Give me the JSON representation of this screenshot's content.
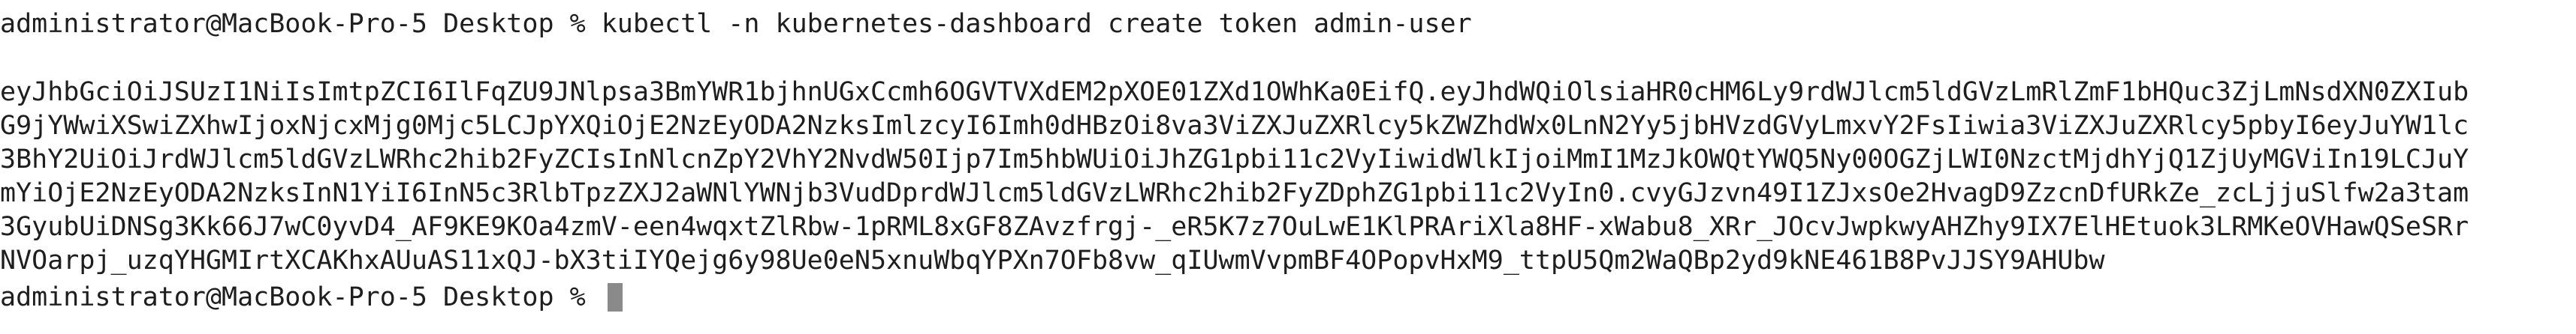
{
  "terminal": {
    "command_prompt": "administrator@MacBook-Pro-5 Desktop % ",
    "command": "kubectl -n kubernetes-dashboard create token admin-user",
    "output_lines": [
      "eyJhbGciOiJSUzI1NiIsImtpZCI6IlFqZU9JNlpsa3BmYWR1bjhnUGxCcmh6OGVTVXdEM2pXOE01ZXd1OWhKa0EifQ.eyJhdWQiOlsiaHR0cHM6Ly9rdWJlcm5ldGVzLmRlZmF1bHQuc3ZjLmNsdXN0ZXIub",
      "G9jYWwiXSwiZXhwIjoxNjcxMjg0Mjc5LCJpYXQiOjE2NzEyODA2NzksImlzcyI6Imh0dHBzOi8va3ViZXJuZXRlcy5kZWZhdWx0LnN2Yy5jbHVzdGVyLmxvY2FsIiwia3ViZXJuZXRlcy5pbyI6eyJuYW1lc",
      "3BhY2UiOiJrdWJlcm5ldGVzLWRhc2hib2FyZCIsInNlcnZpY2VhY2NvdW50Ijp7Im5hbWUiOiJhZG1pbi11c2VyIiwidWlkIjoiMmI1MzJkOWQtYWQ5Ny00OGZjLWI0NzctMjdhYjQ1ZjUyMGViIn19LCJuY",
      "mYiOjE2NzEyODA2NzksInN1YiI6InN5c3RlbTpzZXJ2aWNlYWNjb3VudDprdWJlcm5ldGVzLWRhc2hib2FyZDphZG1pbi11c2VyIn0.cvyGJzvn49I1ZJxsOe2HvagD9ZzcnDfURkZe_zcLjjuSlfw2a3tam",
      "3GyubUiDNSg3Kk66J7wC0yvD4_AF9KE9KOa4zmV-een4wqxtZlRbw-1pRML8xGF8ZAvzfrgj-_eR5K7z7OuLwE1KlPRAriXla8HF-xWabu8_XRr_JOcvJwpkwyAHZhy9IX7ElHEtuok3LRMKeOVHawQSeSRr",
      "NVOarpj_uzqYHGMIrtXCAKhxAUuAS11xQJ-bX3tiIYQejg6y98Ue0eN5xnuWbqYPXn7OFb8vw_qIUwmVvpmBF4OPopvHxM9_ttpU5Qm2WaQBp2yd9kNE461B8PvJJSY9AHUbw"
    ],
    "final_prompt": "administrator@MacBook-Pro-5 Desktop % "
  }
}
